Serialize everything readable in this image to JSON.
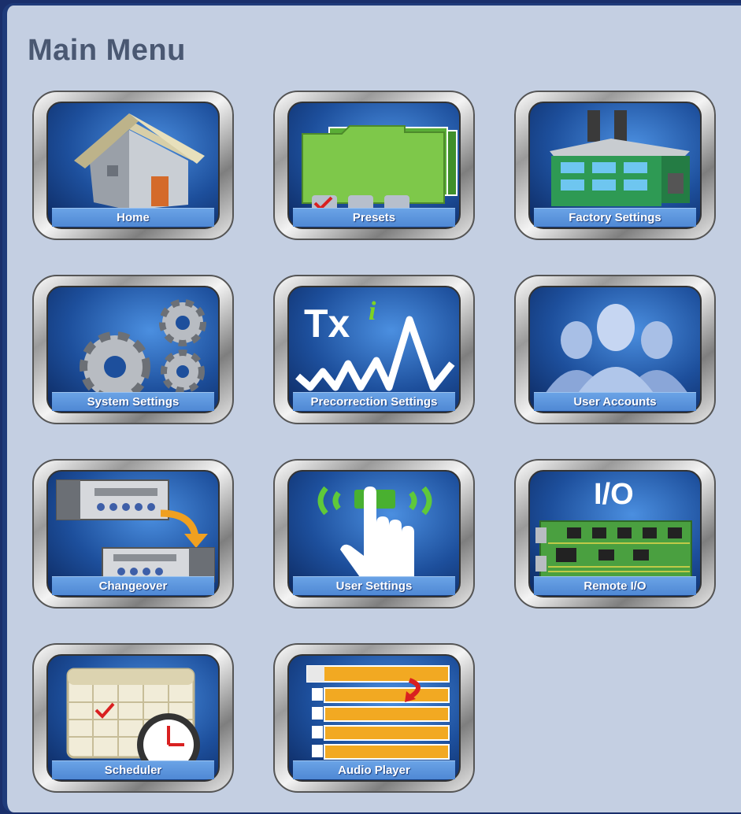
{
  "page": {
    "title": "Main Menu"
  },
  "tiles": [
    {
      "id": "home",
      "label": "Home",
      "icon": "house-icon"
    },
    {
      "id": "presets",
      "label": "Presets",
      "icon": "folders-icon"
    },
    {
      "id": "factory-settings",
      "label": "Factory Settings",
      "icon": "factory-icon"
    },
    {
      "id": "system-settings",
      "label": "System Settings",
      "icon": "gears-icon"
    },
    {
      "id": "precorrection-settings",
      "label": "Precorrection Settings",
      "icon": "txi-waveform-icon",
      "icon_text": "Tx",
      "icon_superscript": "i"
    },
    {
      "id": "user-accounts",
      "label": "User Accounts",
      "icon": "users-icon"
    },
    {
      "id": "changeover",
      "label": "Changeover",
      "icon": "changeover-icon"
    },
    {
      "id": "user-settings",
      "label": "User Settings",
      "icon": "touch-hand-icon"
    },
    {
      "id": "remote-io",
      "label": "Remote I/O",
      "icon": "circuit-board-icon",
      "icon_text": "I/O"
    },
    {
      "id": "scheduler",
      "label": "Scheduler",
      "icon": "calendar-clock-icon"
    },
    {
      "id": "audio-player",
      "label": "Audio Player",
      "icon": "playlist-icon"
    }
  ],
  "colors": {
    "panel_bg": "#c4cfe2",
    "panel_border": "#1f3b7a",
    "title": "#4a5872",
    "icon_bg": "#1d4f9c",
    "label_bg": "#5b93dc"
  }
}
